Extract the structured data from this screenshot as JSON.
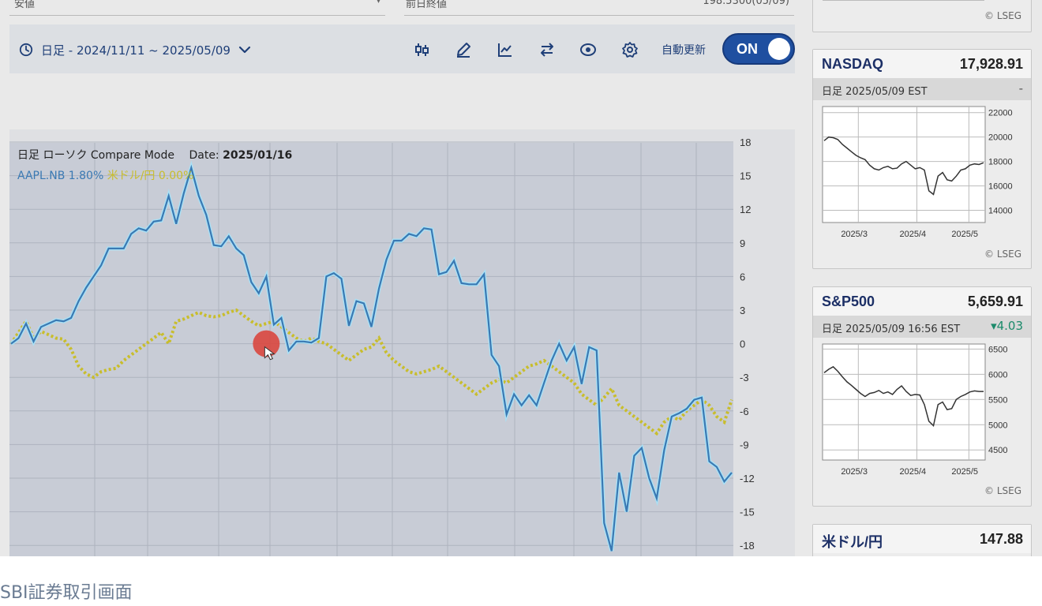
{
  "top_fields": {
    "left_label": "安値",
    "right_label": "前日終値",
    "right_value": "198.5300(05/09)"
  },
  "toolbar": {
    "range_label": "日足 - 2024/11/11 ~ 2025/05/09",
    "auto_update_label": "自動更新",
    "toggle_label": "ON",
    "icons": [
      "clock-icon",
      "chevron-down-icon",
      "candlestick-icon",
      "pencil-icon",
      "line-chart-icon",
      "swap-icon",
      "eye-icon",
      "gear-icon"
    ]
  },
  "chart_data": {
    "type": "line",
    "mode_label": "日足 ローソク Compare Mode",
    "date_label": "Date:",
    "date_value": "2025/01/16",
    "ylim": [
      -18,
      18
    ],
    "yticks": [
      18,
      15,
      12,
      9,
      6,
      3,
      0,
      -3,
      -6,
      -9,
      -12,
      -15,
      -18
    ],
    "series": [
      {
        "name": "AAPL.NB",
        "pct_label": "1.80%",
        "color": "#3a79b3",
        "values": [
          0,
          0.5,
          1.8,
          0.2,
          1.5,
          1.8,
          2.1,
          2.0,
          2.3,
          3.8,
          5,
          6,
          7,
          8.5,
          8.5,
          8.5,
          9.8,
          10.3,
          10.1,
          10.9,
          11.0,
          13.2,
          10.7,
          13.4,
          15.7,
          13.2,
          11.5,
          8.8,
          8.7,
          9.6,
          8.5,
          7.9,
          5.5,
          4.5,
          6.0,
          1.7,
          2.3,
          -0.6,
          0.2,
          0.2,
          0.1,
          0.5,
          6.0,
          6.3,
          5.8,
          1.6,
          3.8,
          3.6,
          1.5,
          4.9,
          7.5,
          9.2,
          9.2,
          9.8,
          9.6,
          10.3,
          10.2,
          6.2,
          6.4,
          7.4,
          5.4,
          5.3,
          5.3,
          6.2,
          -1.0,
          -2.0,
          -6.3,
          -4.5,
          -5.5,
          -4.6,
          -5.5,
          -3.5,
          -1.5,
          0,
          -1.5,
          -0.3,
          -3.6,
          -0.3,
          -0.6,
          -16.0,
          -18.5,
          -11.5,
          -15.0,
          -10.0,
          -9.3,
          -12.0,
          -13.8,
          -9.5,
          -6.5,
          -6.2,
          -5.8,
          -5.0,
          -4.8,
          -10.5,
          -11.0,
          -12.3,
          -11.5
        ]
      },
      {
        "name": "米ドル/円",
        "pct_label": "0.00%",
        "color": "#c8bd2c",
        "values": [
          0,
          1.0,
          2.0,
          0.5,
          1.1,
          0.8,
          0.5,
          0.4,
          -0.5,
          -2.0,
          -2.7,
          -3.0,
          -2.5,
          -2.3,
          -2.2,
          -1.5,
          -1.0,
          -0.5,
          0,
          0.5,
          1.0,
          0,
          2.0,
          2.2,
          2.5,
          2.8,
          2.5,
          2.4,
          2.5,
          2.8,
          3.0,
          2.5,
          2.0,
          1.6,
          1.8,
          2.0,
          1.5,
          1.0,
          0.5,
          0.2,
          0.5,
          0.2,
          0,
          -0.5,
          -1.0,
          -1.5,
          -1.0,
          -0.5,
          -0.3,
          0.5,
          -0.8,
          -1.5,
          -2.0,
          -2.5,
          -2.7,
          -2.5,
          -2.3,
          -2.0,
          -2.5,
          -3.0,
          -3.5,
          -4.0,
          -4.5,
          -4.0,
          -3.5,
          -3.2,
          -3.5,
          -3.0,
          -2.5,
          -2.0,
          -1.8,
          -1.5,
          -2.0,
          -2.5,
          -3.0,
          -3.5,
          -4.5,
          -5.0,
          -5.5,
          -4.8,
          -4.0,
          -5.5,
          -6.0,
          -6.5,
          -7.0,
          -7.5,
          -8.0,
          -7.0,
          -6.5,
          -6.8,
          -6.0,
          -5.5,
          -5.0,
          -5.5,
          -6.5,
          -7.0,
          -5.0
        ]
      }
    ],
    "cursor": {
      "index": 34,
      "value": 0
    }
  },
  "cards": [
    {
      "name": "NASDAQ",
      "value": "17,928.91",
      "date": "日足 2025/05/09 EST",
      "change": "-",
      "change_dir": "flat",
      "lseg": "© LSEG",
      "yticks": [
        "22000",
        "20000",
        "18000",
        "16000",
        "14000"
      ],
      "ylim": [
        13000,
        22500
      ],
      "xticks": [
        "2025/3",
        "2025/4",
        "2025/5"
      ],
      "values": [
        19700,
        20000,
        19950,
        19800,
        19400,
        19100,
        18800,
        18500,
        18300,
        18150,
        17700,
        17400,
        17300,
        17500,
        17600,
        17400,
        17450,
        17800,
        18000,
        17700,
        17400,
        17500,
        17300,
        15600,
        15300,
        16800,
        17100,
        16500,
        16400,
        16800,
        17300,
        17400,
        17700,
        17800,
        17750,
        17900
      ]
    },
    {
      "name": "S&P500",
      "value": "5,659.91",
      "date": "日足 2025/05/09 16:56 EST",
      "change": "▾4.03",
      "change_dir": "down",
      "lseg": "© LSEG",
      "yticks": [
        "6500",
        "6000",
        "5500",
        "5000",
        "4500"
      ],
      "ylim": [
        4300,
        6600
      ],
      "xticks": [
        "2025/3",
        "2025/4",
        "2025/5"
      ],
      "values": [
        6030,
        6100,
        6150,
        6060,
        5950,
        5850,
        5780,
        5700,
        5620,
        5560,
        5620,
        5640,
        5680,
        5620,
        5650,
        5600,
        5700,
        5770,
        5660,
        5580,
        5600,
        5590,
        5400,
        5070,
        4980,
        5400,
        5450,
        5300,
        5320,
        5500,
        5560,
        5600,
        5650,
        5670,
        5660,
        5660
      ]
    },
    {
      "name": "米ドル/円",
      "value": "147.88"
    }
  ],
  "nasdaq_top_clip": {
    "lseg": "© LSEG"
  },
  "caption": "SBI証券取引画面"
}
